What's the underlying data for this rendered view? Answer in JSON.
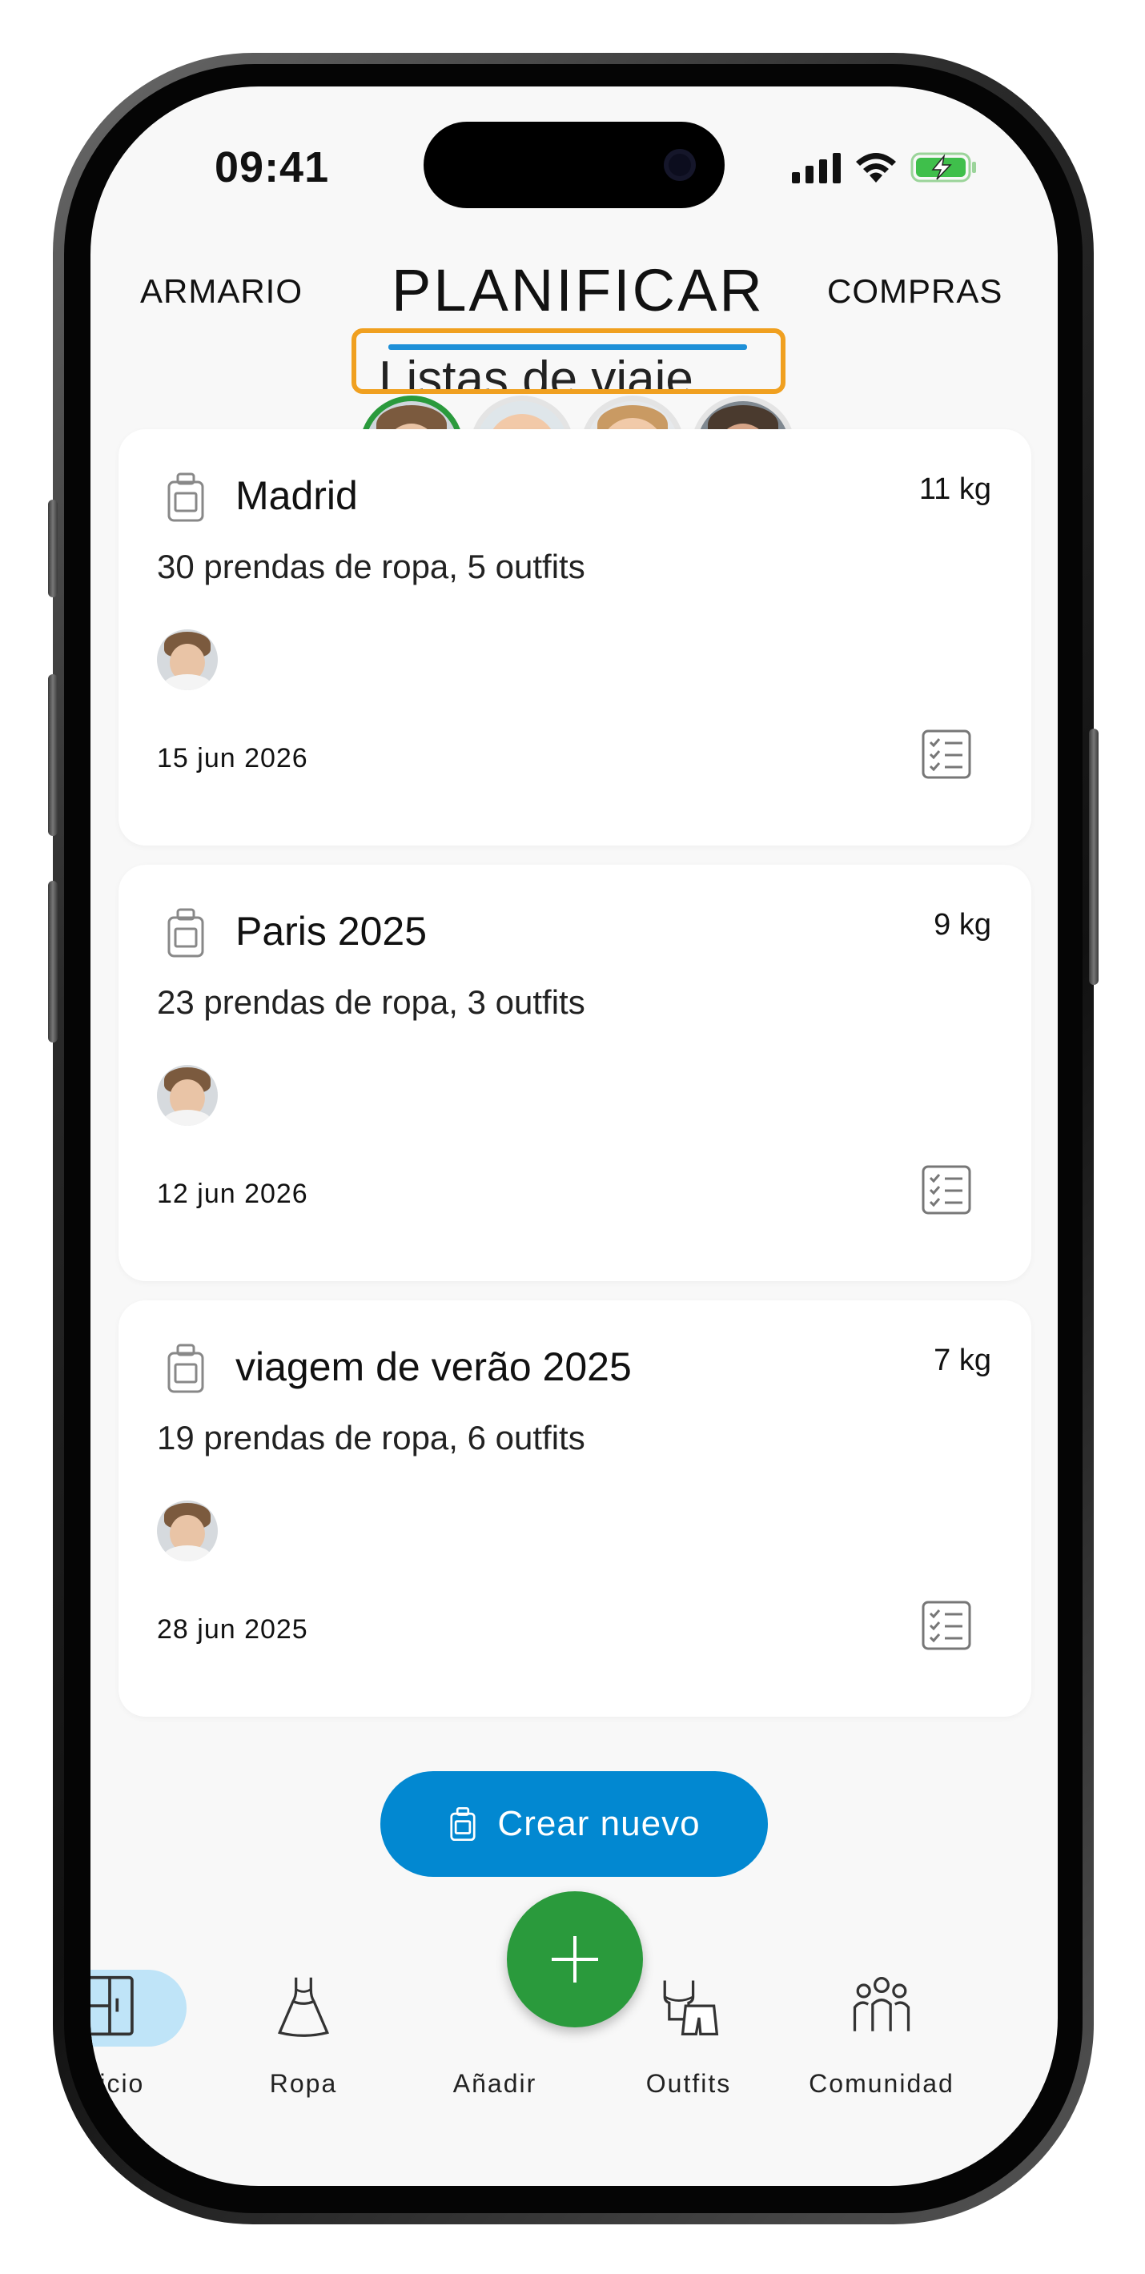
{
  "status_bar": {
    "time": "09:41"
  },
  "header": {
    "tabs": [
      {
        "label": "ARMARIO"
      },
      {
        "label": "PLANIFICAR"
      },
      {
        "label": "COMPRAS"
      }
    ],
    "subtitle": "Listas de viaje"
  },
  "profiles": [
    {
      "name": "mother",
      "selected": true
    },
    {
      "name": "baby"
    },
    {
      "name": "child"
    },
    {
      "name": "man"
    }
  ],
  "trips": [
    {
      "title": "Madrid",
      "weight": "11 kg",
      "summary": "30 prendas de ropa, 5 outfits",
      "date": "15 jun 2026"
    },
    {
      "title": "Paris 2025",
      "weight": "9 kg",
      "summary": "23 prendas de ropa, 3 outfits",
      "date": "12 jun 2026"
    },
    {
      "title": "viagem de verão 2025",
      "weight": "7 kg",
      "summary": "19 prendas de ropa, 6 outfits",
      "date": "28 jun 2025"
    }
  ],
  "create_button": {
    "label": "Crear nuevo"
  },
  "bottom_nav": {
    "items": [
      {
        "label": "Inicio",
        "icon": "wardrobe-icon",
        "active": true
      },
      {
        "label": "Ropa",
        "icon": "dress-icon"
      },
      {
        "label": "Añadir",
        "icon": "plus-icon"
      },
      {
        "label": "Outfits",
        "icon": "outfit-icon"
      },
      {
        "label": "Comunidad",
        "icon": "community-icon"
      }
    ]
  },
  "colors": {
    "accent_blue": "#0288d1",
    "green": "#2a9a3c",
    "highlight_orange": "#f0a020",
    "underline": "#1e90d8",
    "nav_active": "#bfe4f8"
  }
}
